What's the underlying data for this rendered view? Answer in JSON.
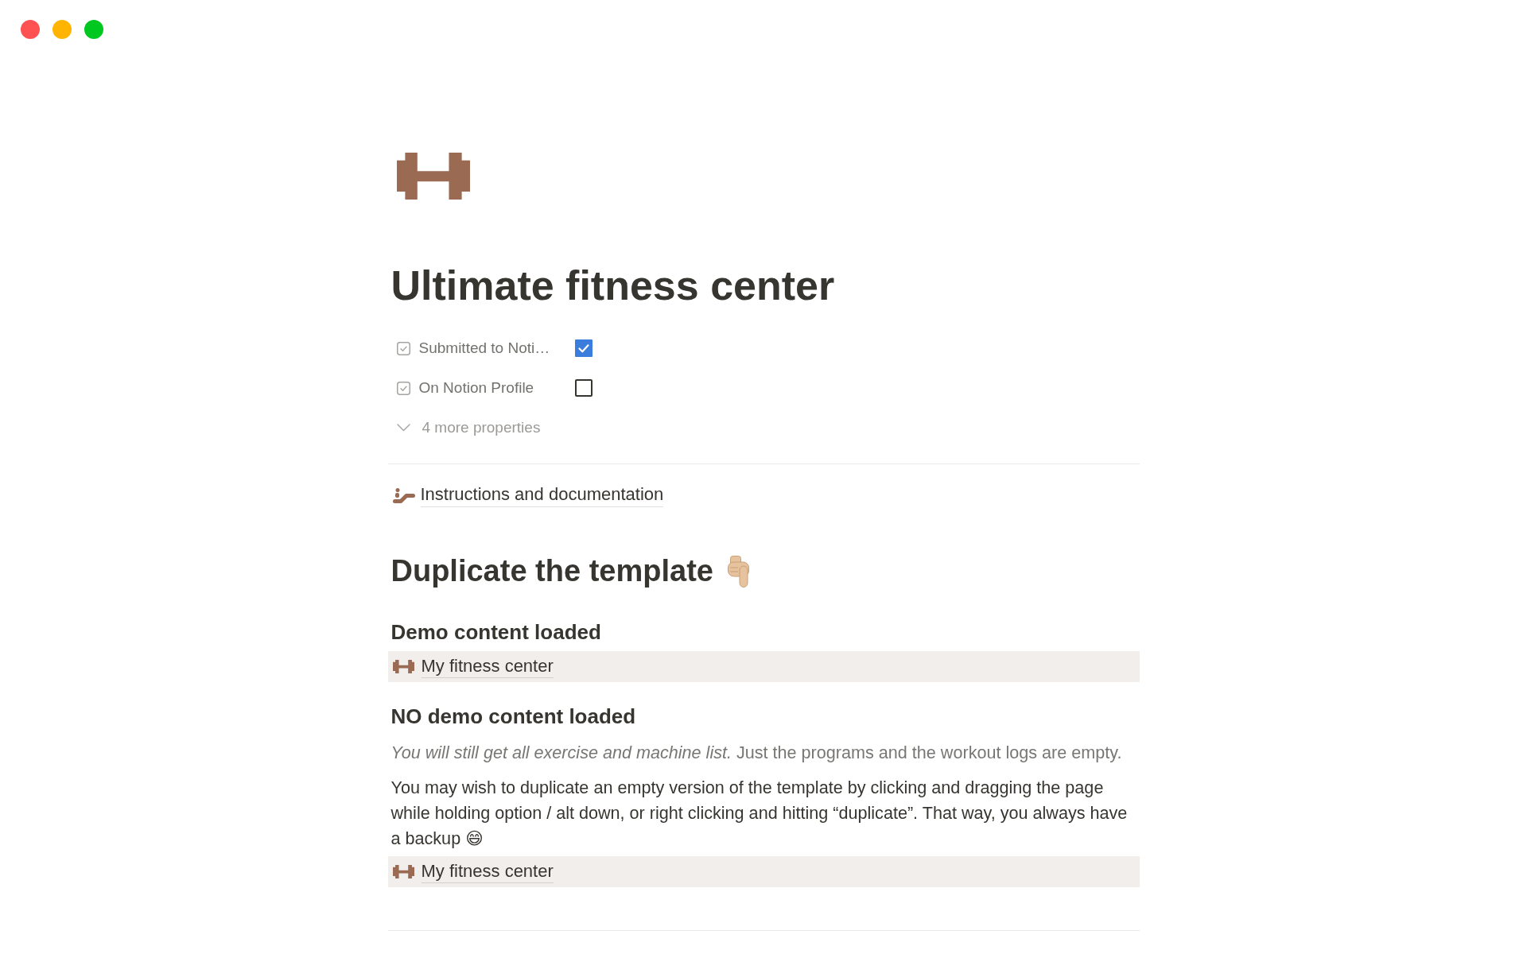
{
  "window_controls": [
    {
      "color": "#fe5152"
    },
    {
      "color": "#feb401"
    },
    {
      "color": "#01c821"
    }
  ],
  "page": {
    "title": "Ultimate fitness center",
    "properties": [
      {
        "label": "Submitted to Noti…",
        "checked": true
      },
      {
        "label": "On Notion Profile",
        "checked": false
      }
    ],
    "more_properties": "4 more properties",
    "blocks": [
      {
        "kind": "link",
        "text": "Instructions and documentation"
      },
      {
        "kind": "heading_1",
        "text": "Duplicate the template"
      },
      {
        "kind": "heading_2",
        "text": "Demo content loaded"
      },
      {
        "kind": "page_block",
        "text": "My fitness center"
      },
      {
        "kind": "heading_2",
        "text": "NO demo content loaded"
      },
      {
        "kind": "note",
        "text": "*You will still get all exercise and machine list.* Just the programs and the workout logs are empty."
      },
      {
        "kind": "paragraph",
        "text": "You may wish to duplicate an empty version of the template by clicking and dragging the page while holding option / alt down, or right clicking and hitting “duplicate”. That way, you always have a backup 😄"
      },
      {
        "kind": "page_block",
        "text": "My fitness center"
      },
      {
        "kind": "divider"
      }
    ]
  }
}
